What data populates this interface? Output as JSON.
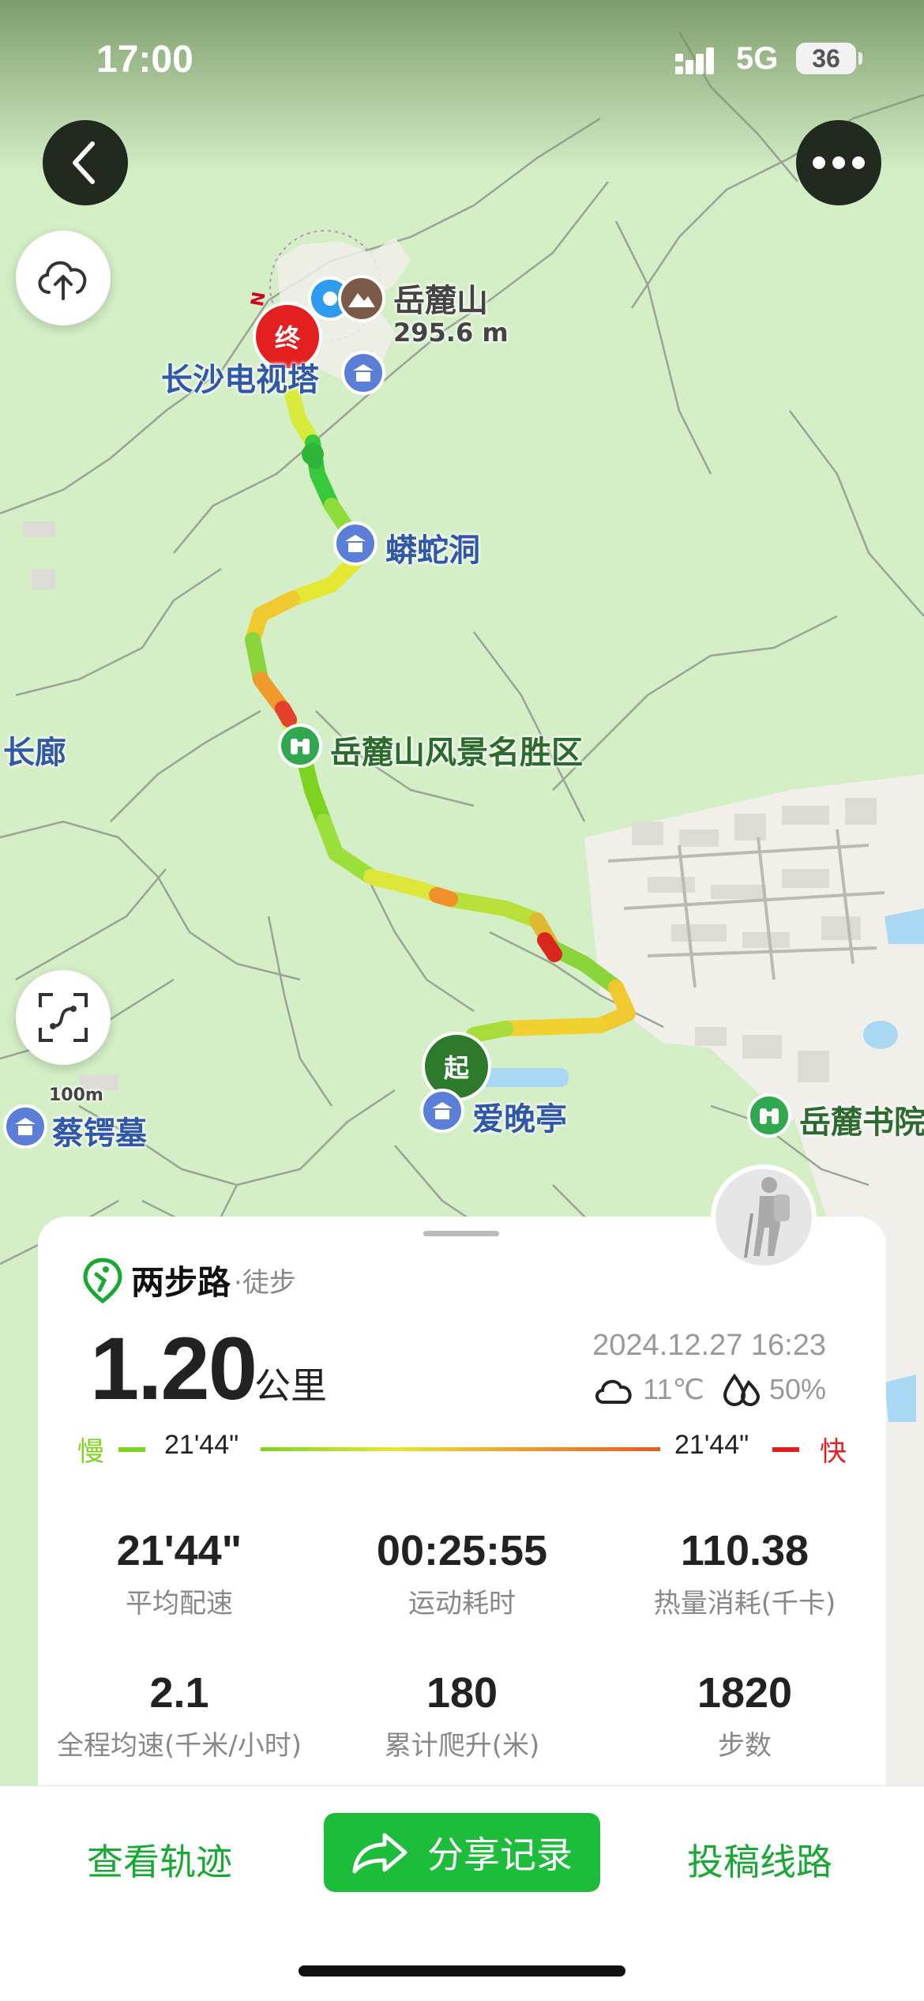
{
  "status_bar": {
    "time": "17:00",
    "network": "5G",
    "battery": "36"
  },
  "map": {
    "labels": {
      "mountain": "岳麓山",
      "elevation": "295.6 m",
      "tv_tower": "长沙电视塔",
      "cave": "蟒蛇洞",
      "scenic": "岳麓山风景名胜区",
      "corridor": "长廊",
      "pavilion": "爱晚亭",
      "tomb": "蔡锷墓",
      "academy": "岳麓书院",
      "scale": "100m"
    },
    "end_marker": "终",
    "start_marker": "起",
    "compass": "N"
  },
  "card": {
    "brand": "两步路",
    "brand_sub": "·徒步",
    "distance": "1.20",
    "distance_unit": "公里",
    "datetime": "2024.12.27 16:23",
    "temperature": "11℃",
    "humidity": "50%",
    "legend": {
      "slow": "慢",
      "slow_pace": "21'44\"",
      "fast_pace": "21'44\"",
      "fast": "快"
    },
    "stats": [
      {
        "value": "21'44\"",
        "label": "平均配速"
      },
      {
        "value": "00:25:55",
        "label": "运动耗时"
      },
      {
        "value": "110.38",
        "label": "热量消耗(千卡)"
      },
      {
        "value": "2.1",
        "label": "全程均速(千米/小时)"
      },
      {
        "value": "180",
        "label": "累计爬升(米)"
      },
      {
        "value": "1820",
        "label": "步数"
      }
    ]
  },
  "bottom_bar": {
    "view_track": "查看轨迹",
    "share": "分享记录",
    "submit_route": "投稿线路"
  },
  "colors": {
    "accent": "#1dbc3a",
    "slow": "#7ed321",
    "fast": "#e02020"
  }
}
